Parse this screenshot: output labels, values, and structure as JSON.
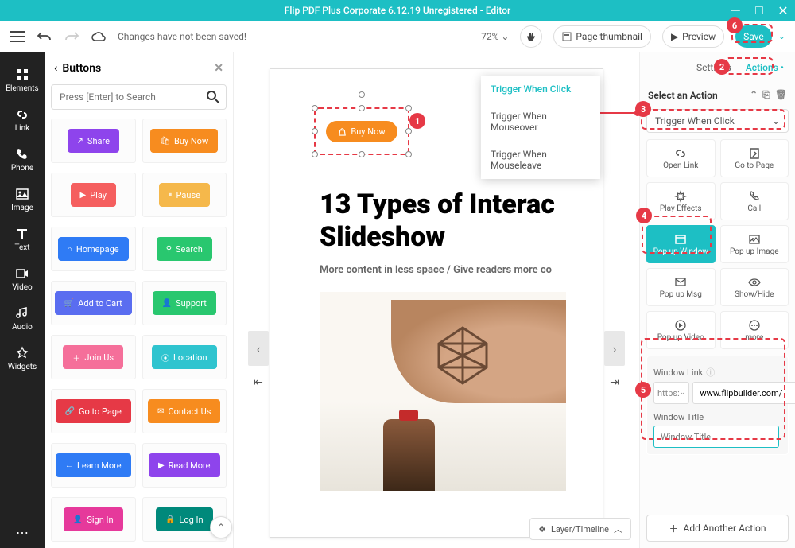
{
  "titlebar": {
    "text": "Flip PDF Plus Corporate 6.12.19 Unregistered - Editor"
  },
  "toolbar": {
    "status": "Changes have not been saved!",
    "zoom": "72%",
    "thumbnail": "Page thumbnail",
    "preview": "Preview",
    "save": "Save"
  },
  "leftbar": {
    "items": [
      "Elements",
      "Link",
      "Phone",
      "Image",
      "Text",
      "Video",
      "Audio",
      "Widgets"
    ]
  },
  "buttons_panel": {
    "title": "Buttons",
    "search_placeholder": "Press [Enter] to Search",
    "samples": [
      [
        {
          "label": "Share",
          "bg": "#8e44ec"
        },
        {
          "label": "Buy Now",
          "bg": "#f78c1f"
        }
      ],
      [
        {
          "label": "Play",
          "bg": "#f55f5f"
        },
        {
          "label": "Pause",
          "bg": "#f5b84b"
        }
      ],
      [
        {
          "label": "Homepage",
          "bg": "#2f7bf5"
        },
        {
          "label": "Search",
          "bg": "#29c76f"
        }
      ],
      [
        {
          "label": "Add to Cart",
          "bg": "#5a6df0"
        },
        {
          "label": "Support",
          "bg": "#29c76f"
        }
      ],
      [
        {
          "label": "Join Us",
          "bg": "#f56f9a"
        },
        {
          "label": "Location",
          "bg": "#2fc4cf"
        }
      ],
      [
        {
          "label": "Go to Page",
          "bg": "#e63946"
        },
        {
          "label": "Contact Us",
          "bg": "#f78c1f"
        }
      ],
      [
        {
          "label": "Learn More",
          "bg": "#2f7bf5"
        },
        {
          "label": "Read More",
          "bg": "#8e44ec"
        }
      ],
      [
        {
          "label": "Sign In",
          "bg": "#e6399b"
        },
        {
          "label": "Log In",
          "bg": "#00897b"
        }
      ]
    ]
  },
  "canvas": {
    "selected_btn": "Buy Now",
    "title_line1": "13 Types of Interac",
    "title_line2": "Slideshow",
    "subtitle": "More content in less space / Give readers more co",
    "layer_label": "Layer/Timeline"
  },
  "trigger_menu": {
    "items": [
      "Trigger When Click",
      "Trigger When Mouseover",
      "Trigger When Mouseleave"
    ],
    "active": 0
  },
  "right_panel": {
    "tabs": [
      "Settings",
      "Actions"
    ],
    "section_title": "Select an Action",
    "trigger_value": "Trigger When Click",
    "actions": [
      {
        "label": "Open Link",
        "icon": "link"
      },
      {
        "label": "Go to Page",
        "icon": "page"
      },
      {
        "label": "Play Effects",
        "icon": "star"
      },
      {
        "label": "Call",
        "icon": "phone"
      },
      {
        "label": "Pop up Window",
        "icon": "window",
        "selected": true
      },
      {
        "label": "Pop up Image",
        "icon": "image"
      },
      {
        "label": "Pop up Msg",
        "icon": "msg"
      },
      {
        "label": "Show/Hide",
        "icon": "eye"
      },
      {
        "label": "Pop up Video",
        "icon": "video"
      },
      {
        "label": "more",
        "icon": "more"
      }
    ],
    "form": {
      "link_label": "Window Link",
      "protocol": "https:",
      "url": "www.flipbuilder.com/",
      "title_label": "Window Title",
      "title_placeholder": "Window Title"
    },
    "add_action": "Add Another Action"
  }
}
